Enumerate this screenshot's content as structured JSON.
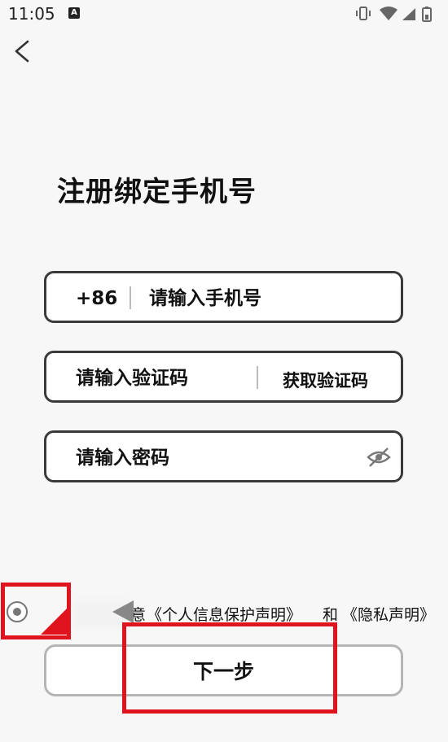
{
  "status_bar": {
    "time": "11:05",
    "notification_letter": "A"
  },
  "page": {
    "title": "注册绑定手机号"
  },
  "phone": {
    "prefix": "+86",
    "placeholder": "请输入手机号"
  },
  "code": {
    "placeholder": "请输入验证码",
    "get_code_label": "获取验证码"
  },
  "password": {
    "placeholder": "请输入密码"
  },
  "agreement": {
    "prefix_visible": "意",
    "link_privacy_protection": "《个人信息保护声明》",
    "and_text": "和",
    "link_privacy": "《隐私声明》",
    "checked": true
  },
  "next_button": {
    "label": "下一步"
  },
  "colors": {
    "annotation_red": "#e0141e",
    "border_dark": "#3a3a3a",
    "button_border": "#b5b5b5"
  }
}
